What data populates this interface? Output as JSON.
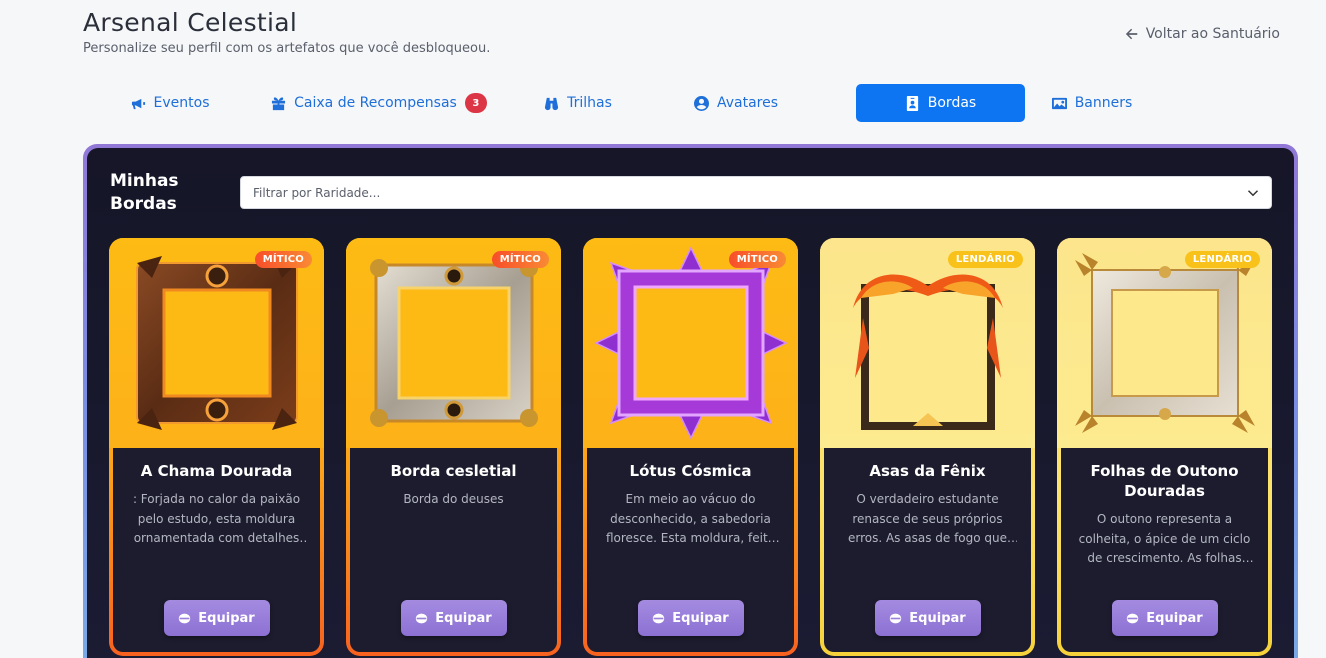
{
  "header": {
    "title": "Arsenal Celestial",
    "subtitle": "Personalize seu perfil com os artefatos que você desbloqueou.",
    "back_label": "Voltar ao Santuário"
  },
  "tabs": [
    {
      "label": "Eventos",
      "icon": "megaphone-icon"
    },
    {
      "label": "Caixa de Recompensas",
      "icon": "gift-box-icon",
      "badge": "3"
    },
    {
      "label": "Trilhas",
      "icon": "binoculars-icon"
    },
    {
      "label": "Avatares",
      "icon": "user-circle-icon"
    },
    {
      "label": "Bordas",
      "icon": "id-badge-icon",
      "active": true
    },
    {
      "label": "Banners",
      "icon": "image-icon"
    }
  ],
  "panel": {
    "title": "Minhas Bordas",
    "filter_placeholder": "Filtrar por Raridade..."
  },
  "cards": [
    {
      "name": "A Chama Dourada",
      "rarity": "MÍTICO",
      "description": ": Forjada no calor da paixão pelo estudo, esta moldura ornamentada com detalhes dourados...",
      "button": "Equipar",
      "frame_color": "#6b3a1e",
      "accent": "#f7621f"
    },
    {
      "name": "Borda cesletial",
      "rarity": "MÍTICO",
      "description": "Borda do deuses",
      "button": "Equipar",
      "frame_color": "#c9c3b8",
      "accent": "#f7621f"
    },
    {
      "name": "Lótus Cósmica",
      "rarity": "MÍTICO",
      "description": "Em meio ao vácuo do desconhecido, a sabedoria floresce. Esta moldura, feita de pétalas...",
      "button": "Equipar",
      "frame_color": "#9b3bd6",
      "accent": "#f7621f"
    },
    {
      "name": "Asas da Fênix",
      "rarity": "LENDÁRIO",
      "description": "O verdadeiro estudante renasce de seus próprios erros. As asas de fogo que envolvem...",
      "button": "Equipar",
      "frame_color": "#e8551b",
      "accent": "#f6d23a"
    },
    {
      "name": "Folhas de Outono Douradas",
      "rarity": "LENDÁRIO",
      "description": "O outono representa a colheita, o ápice de um ciclo de crescimento. As folhas douradas...",
      "button": "Equipar",
      "frame_color": "#d8cfc2",
      "accent": "#f6d23a"
    }
  ]
}
